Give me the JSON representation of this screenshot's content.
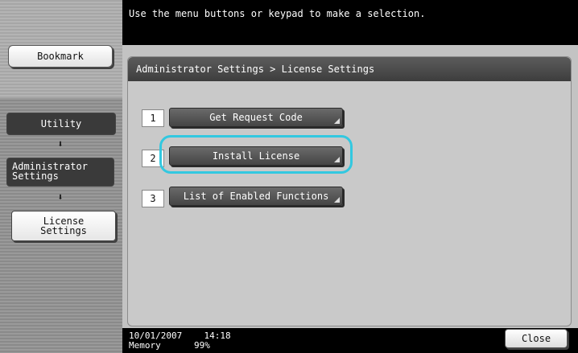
{
  "message": "Use the menu buttons or keypad to make a selection.",
  "sidebar": {
    "bookmark": "Bookmark",
    "nav": [
      {
        "label": "Utility"
      },
      {
        "label": "Administrator\nSettings"
      },
      {
        "label": "License\nSettings"
      }
    ],
    "arrow_icon": "down-arrow-icon"
  },
  "breadcrumb": "Administrator Settings > License Settings",
  "menu": [
    {
      "number": "1",
      "label": "Get Request Code"
    },
    {
      "number": "2",
      "label": "Install License"
    },
    {
      "number": "3",
      "label": "List of Enabled Functions"
    }
  ],
  "highlight_color": "#32c8e0",
  "status": {
    "date": "10/01/2007",
    "time": "14:18",
    "memory_label": "Memory",
    "memory_value": "99%"
  },
  "close_button": "Close"
}
